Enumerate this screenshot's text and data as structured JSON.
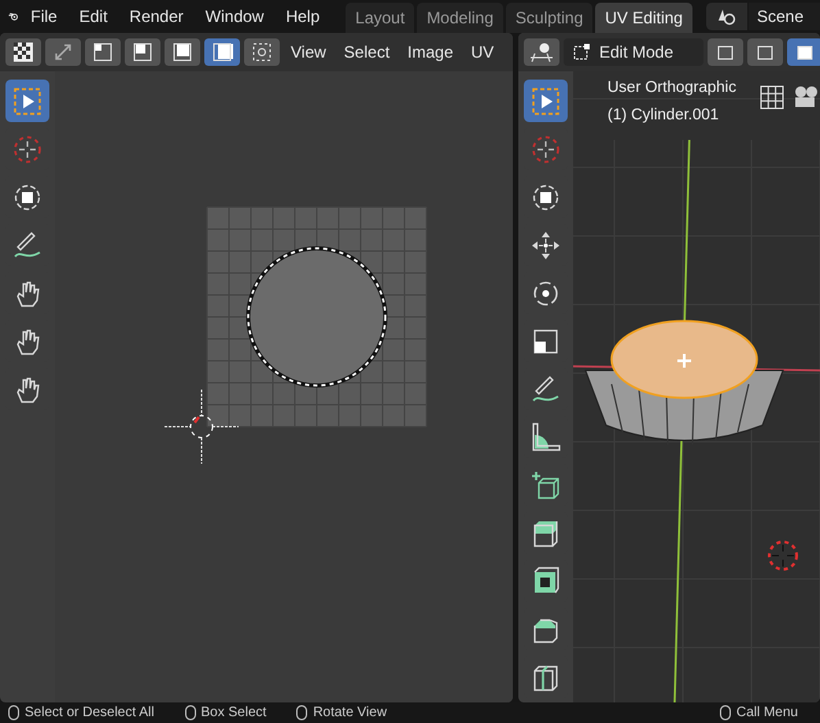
{
  "menu_bar": {
    "items": [
      "File",
      "Edit",
      "Render",
      "Window",
      "Help"
    ]
  },
  "workspace_tabs": [
    {
      "label": "Layout",
      "selected": false
    },
    {
      "label": "Modeling",
      "selected": false
    },
    {
      "label": "Sculpting",
      "selected": false
    },
    {
      "label": "UV Editing",
      "selected": true
    }
  ],
  "scene": {
    "name": "Scene"
  },
  "uv_editor": {
    "menu": [
      "View",
      "Select",
      "Image",
      "UV"
    ],
    "sync_modes": [
      {
        "selected": false
      },
      {
        "selected": false
      },
      {
        "selected": false
      },
      {
        "selected": true
      }
    ],
    "tools": [
      {
        "kind": "select",
        "selected": true
      },
      {
        "kind": "cursor",
        "selected": false
      },
      {
        "kind": "transform",
        "selected": false
      },
      {
        "kind": "annotate",
        "selected": false
      },
      {
        "kind": "grab",
        "selected": false
      },
      {
        "kind": "pinch",
        "selected": false
      },
      {
        "kind": "hand",
        "selected": false
      }
    ]
  },
  "viewport": {
    "mode": "Edit Mode",
    "select_modes": [
      {
        "selected": false
      },
      {
        "selected": false
      },
      {
        "selected": true
      }
    ],
    "view_name": "User Orthographic",
    "object_name": "(1) Cylinder.001",
    "tools": [
      {
        "kind": "select",
        "selected": true
      },
      {
        "kind": "cursor",
        "selected": false
      },
      {
        "kind": "transform",
        "selected": false
      },
      {
        "kind": "move",
        "selected": false
      },
      {
        "kind": "rotate",
        "selected": false
      },
      {
        "kind": "scale",
        "selected": false
      },
      {
        "kind": "annotate",
        "selected": false
      },
      {
        "kind": "measure",
        "selected": false
      },
      {
        "kind": "add-cube",
        "selected": false
      },
      {
        "kind": "extrude",
        "selected": false
      },
      {
        "kind": "inset",
        "selected": false
      },
      {
        "kind": "bevel",
        "selected": false
      },
      {
        "kind": "loop-cut",
        "selected": false
      }
    ]
  },
  "status_bar": {
    "items": [
      "Select or Deselect All",
      "Box Select",
      "Rotate View",
      "Call Menu"
    ]
  }
}
